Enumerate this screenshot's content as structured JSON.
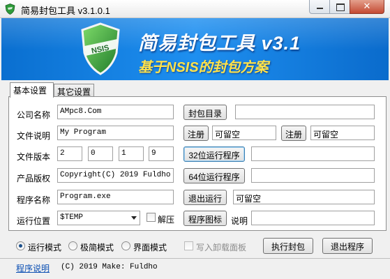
{
  "window": {
    "title": "简易封包工具 v3.1.0.1",
    "close_glyph": "✕"
  },
  "banner": {
    "logo_text": "NSIS",
    "title": "简易封包工具 v3.1",
    "subtitle": "基于NSIS的封包方案"
  },
  "tabs": [
    {
      "label": "基本设置",
      "active": true
    },
    {
      "label": "其它设置",
      "active": false
    }
  ],
  "form": {
    "company": {
      "label": "公司名称",
      "value": "AMpc8.Com",
      "button": "封包目录",
      "extra_value": ""
    },
    "description": {
      "label": "文件说明",
      "value": "My Program",
      "button1": "注册",
      "optional1": "可留空",
      "button2": "注册",
      "optional2": "可留空"
    },
    "version": {
      "label": "文件版本",
      "parts": [
        "2",
        "0",
        "1",
        "9"
      ],
      "button": "32位运行程序",
      "extra_value": ""
    },
    "copyright": {
      "label": "产品版权",
      "value": "Copyright(C) 2019 Fuldho",
      "button": "64位运行程序",
      "extra_value": ""
    },
    "program": {
      "label": "程序名称",
      "value": "Program.exe",
      "button": "退出运行",
      "optional": "可留空"
    },
    "location": {
      "label": "运行位置",
      "value": "$TEMP",
      "unzip_label": "解压",
      "button": "程序图标",
      "note_label": "说明",
      "note_value": ""
    }
  },
  "modes": [
    {
      "label": "运行模式",
      "checked": true
    },
    {
      "label": "极简模式",
      "checked": false
    },
    {
      "label": "界面模式",
      "checked": false
    }
  ],
  "uninstall_label": "写入卸载面板",
  "actions": {
    "run": "执行封包",
    "exit": "退出程序"
  },
  "footer": {
    "link": "程序说明",
    "text": "(C) 2019 Make: Fuldho"
  },
  "colors": {
    "banner_blue": "#1e8ff0",
    "subtitle_yellow": "#ffe24a",
    "shield_green": "#2e9b3a",
    "link_blue": "#0b4fb3"
  }
}
